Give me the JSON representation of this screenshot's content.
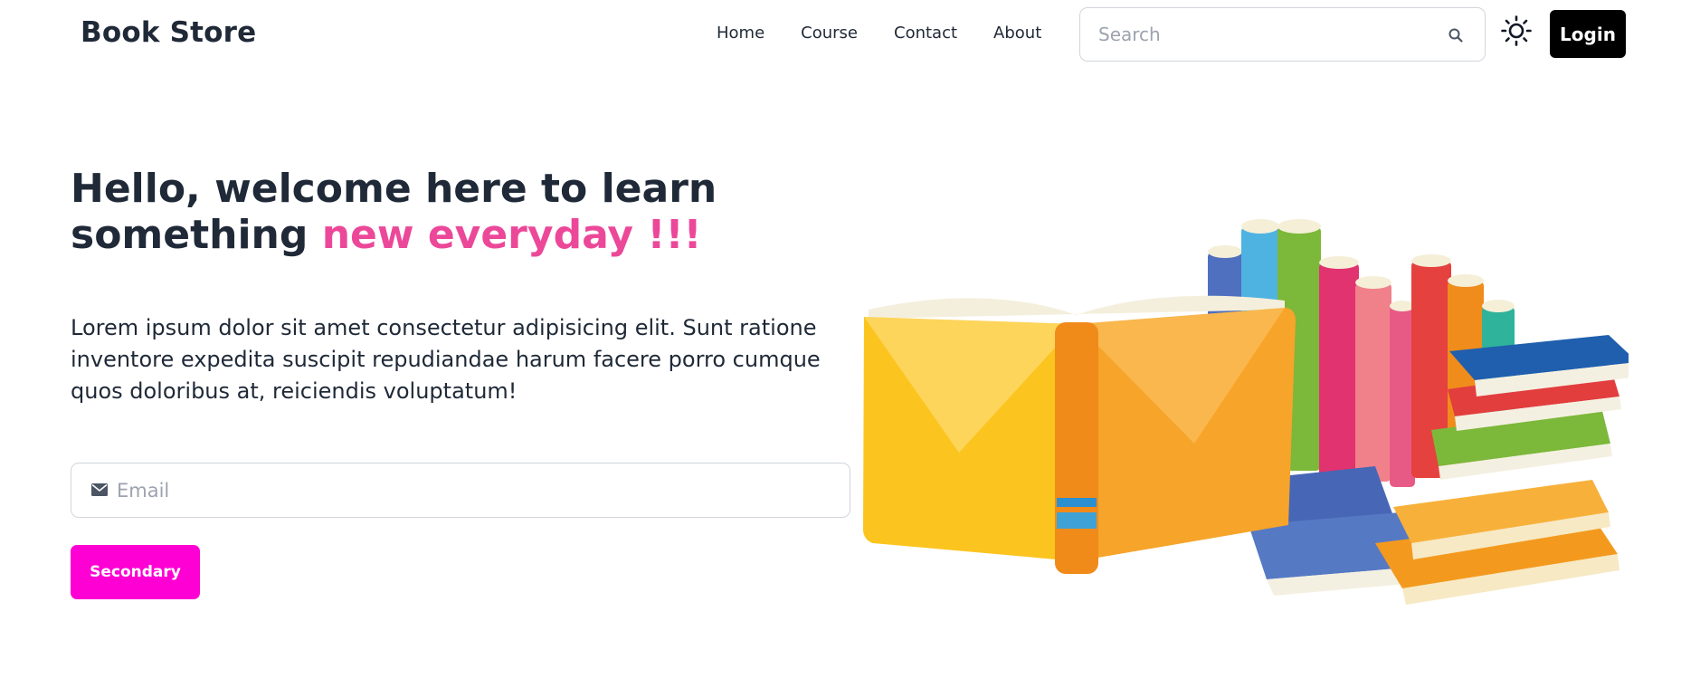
{
  "header": {
    "brand": "Book Store",
    "nav": [
      "Home",
      "Course",
      "Contact",
      "About"
    ],
    "search_placeholder": "Search",
    "login_label": "Login"
  },
  "hero": {
    "title_main": "Hello, welcome here to learn something ",
    "title_accent": "new everyday !!!",
    "description": "Lorem ipsum dolor sit amet consectetur adipisicing elit. Sunt ratione inventore expedita suscipit repudiandae harum facere porro cumque quos doloribus at, reiciendis voluptatum!",
    "email_placeholder": "Email",
    "cta_label": "Secondary"
  },
  "colors": {
    "accent": "#ec4899",
    "cta": "#ff00d4",
    "login_bg": "#000000",
    "text": "#1f2937"
  },
  "icons": {
    "search": "search-icon",
    "theme": "sun-icon",
    "email": "envelope-icon"
  }
}
